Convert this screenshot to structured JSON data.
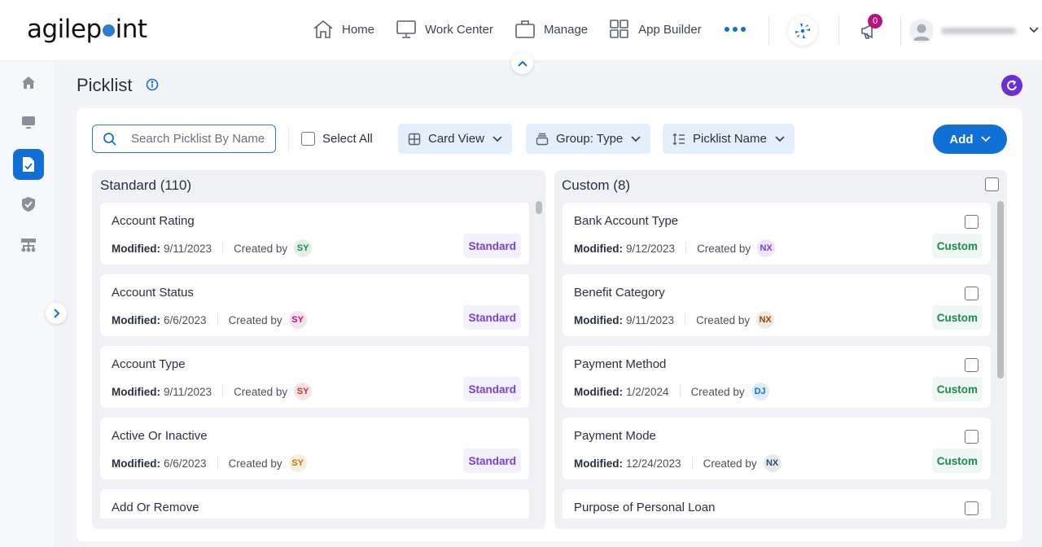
{
  "header": {
    "logo": {
      "prefix": "agilep",
      "suffix": "int"
    },
    "nav": [
      {
        "label": "Home",
        "icon": "home-icon"
      },
      {
        "label": "Work Center",
        "icon": "monitor-icon"
      },
      {
        "label": "Manage",
        "icon": "briefcase-icon"
      },
      {
        "label": "App Builder",
        "icon": "grid-icon"
      }
    ],
    "more_icon": "more-horizontal-icon",
    "notification_count": "0",
    "user_name": "(blurred)"
  },
  "sidebar": {
    "items": [
      {
        "name": "home",
        "icon": "home-icon",
        "active": false
      },
      {
        "name": "work-center",
        "icon": "monitor-icon",
        "active": false
      },
      {
        "name": "picklist",
        "icon": "document-check-icon",
        "active": true
      },
      {
        "name": "security",
        "icon": "shield-check-icon",
        "active": false
      },
      {
        "name": "hierarchy",
        "icon": "org-chart-icon",
        "active": false
      }
    ]
  },
  "page": {
    "title": "Picklist",
    "search_placeholder": "Search Picklist By Name",
    "search_value": "",
    "select_all_label": "Select All",
    "view_label": "Card View",
    "group_label": "Group: Type",
    "sort_label": "Picklist Name",
    "add_label": "Add"
  },
  "colors": {
    "accent": "#1170d6",
    "standard_tag": "#7a3fd6",
    "custom_tag": "#1e8a4b",
    "refresh": "#6a2fd6",
    "badge": "#b7137a"
  },
  "groups": {
    "standard": {
      "title": "Standard (110)",
      "cards": [
        {
          "name": "Account Rating",
          "modified_label": "Modified:",
          "modified": "9/11/2023",
          "created_by_label": "Created by",
          "initials": "SY",
          "avatar_bg": "#e0f0e5",
          "avatar_fg": "#1e8a4b",
          "tag": "Standard"
        },
        {
          "name": "Account Status",
          "modified_label": "Modified:",
          "modified": "6/6/2023",
          "created_by_label": "Created by",
          "initials": "SY",
          "avatar_bg": "#f8e1ef",
          "avatar_fg": "#b7137a",
          "tag": "Standard"
        },
        {
          "name": "Account Type",
          "modified_label": "Modified:",
          "modified": "9/11/2023",
          "created_by_label": "Created by",
          "initials": "SY",
          "avatar_bg": "#f8e3e6",
          "avatar_fg": "#c0392b",
          "tag": "Standard"
        },
        {
          "name": "Active Or Inactive",
          "modified_label": "Modified:",
          "modified": "6/6/2023",
          "created_by_label": "Created by",
          "initials": "SY",
          "avatar_bg": "#f8eedb",
          "avatar_fg": "#c07a12",
          "tag": "Standard"
        },
        {
          "name": "Add Or Remove",
          "modified_label": "",
          "modified": "",
          "created_by_label": "",
          "initials": "",
          "avatar_bg": "",
          "avatar_fg": "",
          "tag": ""
        }
      ]
    },
    "custom": {
      "title": "Custom (8)",
      "cards": [
        {
          "name": "Bank Account Type",
          "modified_label": "Modified:",
          "modified": "9/12/2023",
          "created_by_label": "Created by",
          "initials": "NX",
          "avatar_bg": "#efe6fb",
          "avatar_fg": "#7a3fd6",
          "tag": "Custom"
        },
        {
          "name": "Benefit Category",
          "modified_label": "Modified:",
          "modified": "9/11/2023",
          "created_by_label": "Created by",
          "initials": "NX",
          "avatar_bg": "#f4e9dd",
          "avatar_fg": "#8a4b12",
          "tag": "Custom"
        },
        {
          "name": "Payment Method",
          "modified_label": "Modified:",
          "modified": "1/2/2024",
          "created_by_label": "Created by",
          "initials": "DJ",
          "avatar_bg": "#dfedfb",
          "avatar_fg": "#1170d6",
          "tag": "Custom"
        },
        {
          "name": "Payment Mode",
          "modified_label": "Modified:",
          "modified": "12/24/2023",
          "created_by_label": "Created by",
          "initials": "NX",
          "avatar_bg": "#e6eaef",
          "avatar_fg": "#2f4a6b",
          "tag": "Custom"
        },
        {
          "name": "Purpose of Personal Loan",
          "modified_label": "",
          "modified": "",
          "created_by_label": "",
          "initials": "",
          "avatar_bg": "",
          "avatar_fg": "",
          "tag": ""
        }
      ]
    }
  }
}
